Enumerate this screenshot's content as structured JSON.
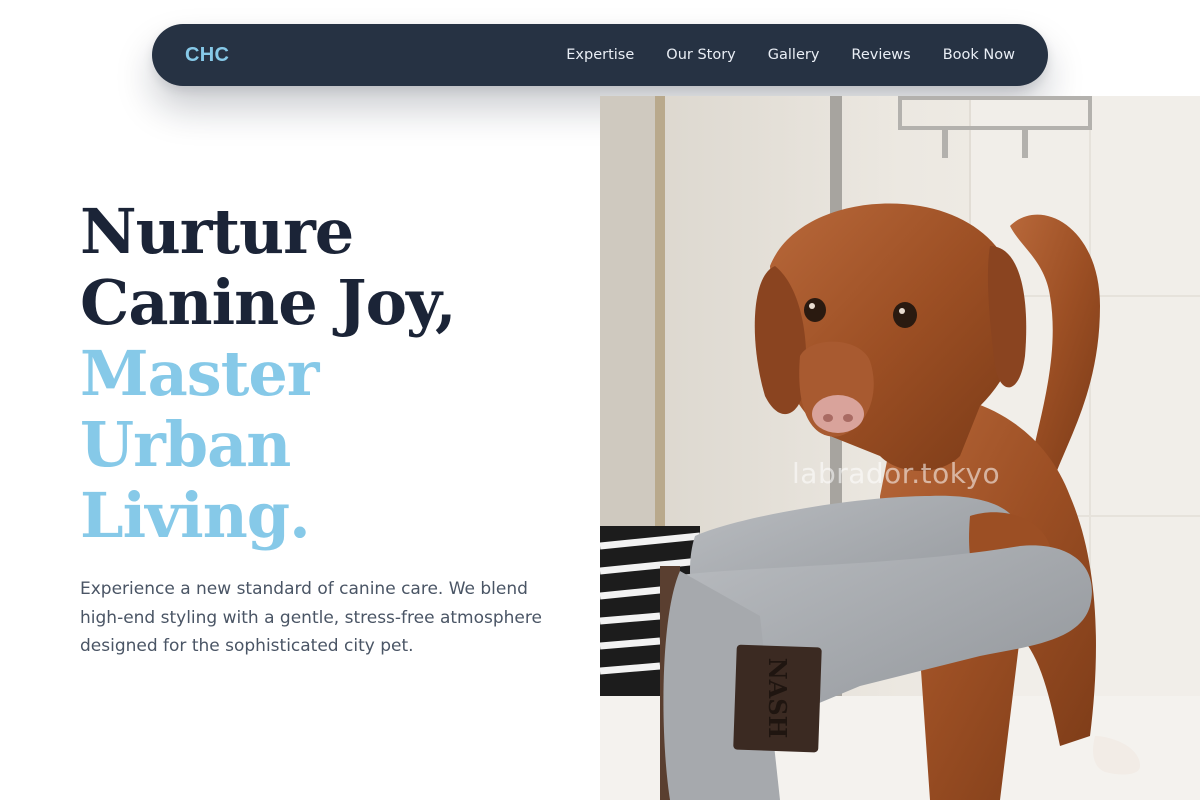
{
  "nav": {
    "logo": "CHC",
    "links": [
      "Expertise",
      "Our Story",
      "Gallery",
      "Reviews",
      "Book Now"
    ]
  },
  "hero": {
    "headline_dark": [
      "Nurture",
      "Canine Joy,"
    ],
    "headline_light": [
      "Master",
      "Urban",
      "Living."
    ],
    "lead": "Experience a new standard of canine care. We blend high-end styling with a gentle, stress-free atmosphere designed for the sophisticated city pet."
  },
  "photo": {
    "watermark": "labrador.tokyo",
    "glove_tag": "NASH"
  },
  "colors": {
    "nav_bg": "#263243",
    "accent": "#86c9e8",
    "headline_dark": "#1b2437",
    "body_text": "#4a5565"
  }
}
